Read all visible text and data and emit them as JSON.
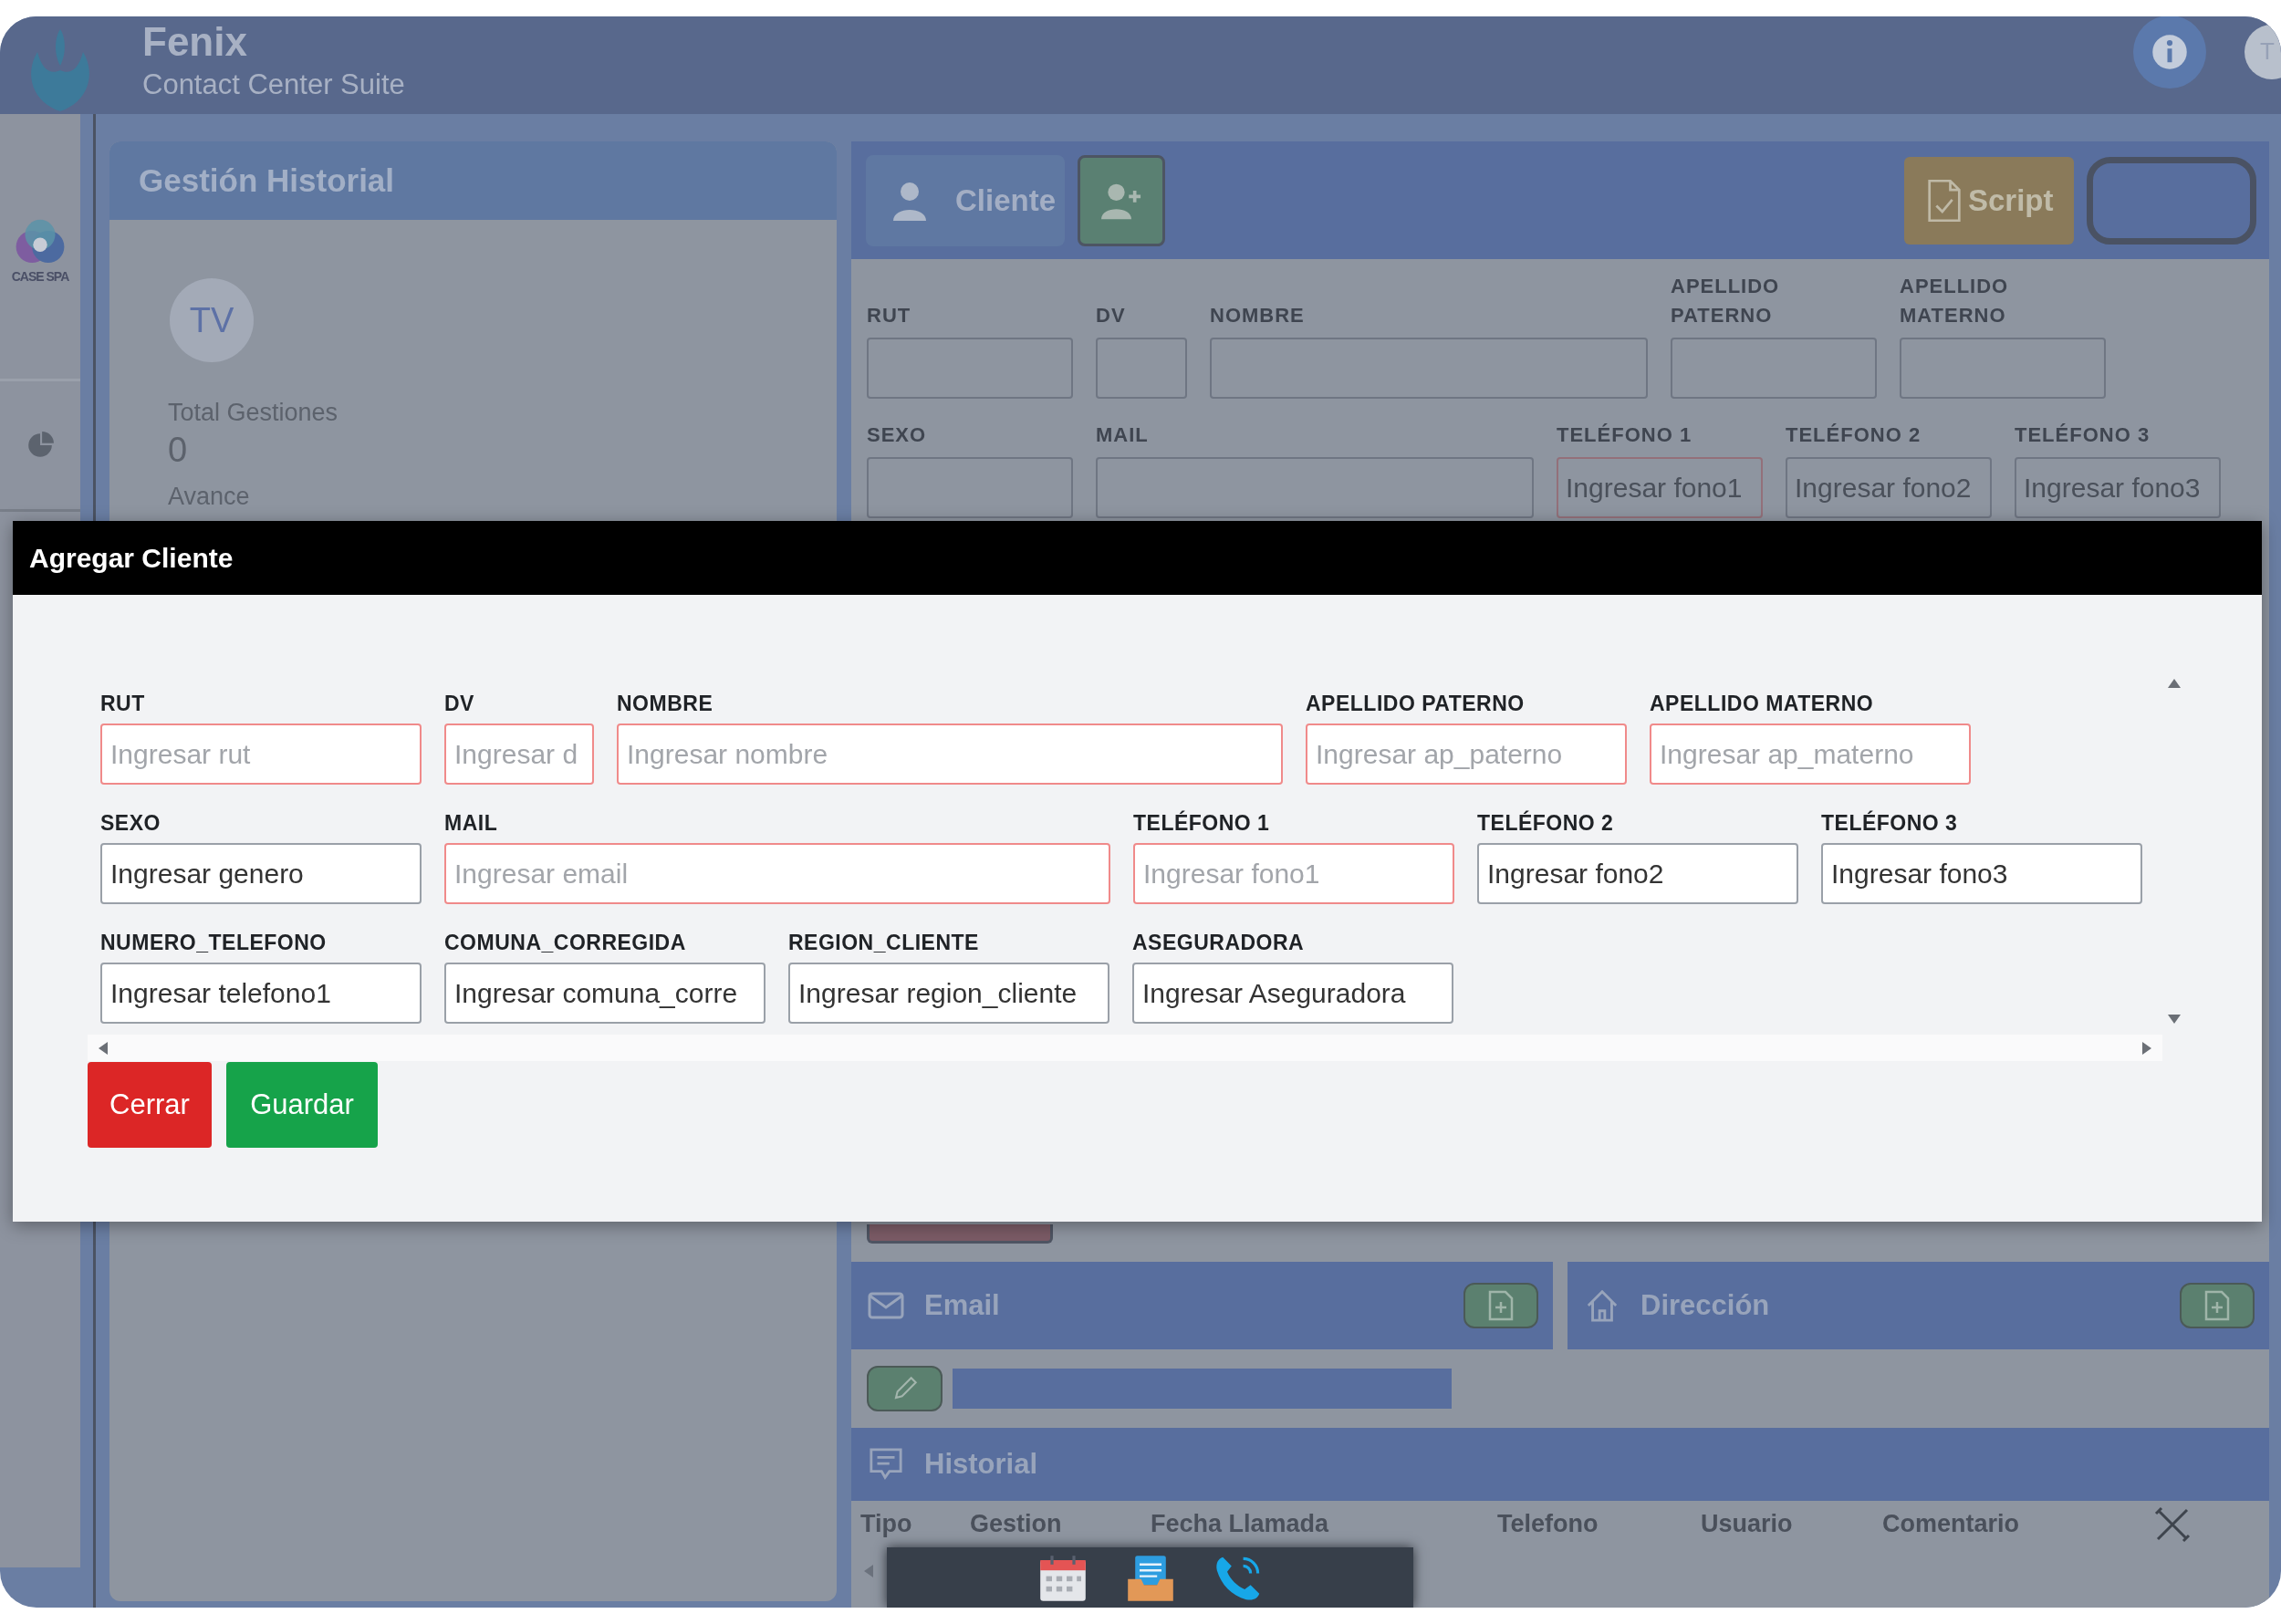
{
  "header": {
    "app_name": "Fenix",
    "subtitle": "Contact Center Suite",
    "avatar": "T"
  },
  "sidebar": {
    "logo_text": "CASE SPA"
  },
  "history_panel": {
    "title": "Gestión Historial",
    "avatar": "TV",
    "total_label": "Total Gestiones",
    "total_value": "0",
    "progress_label": "Avance"
  },
  "client_panel": {
    "tab": "Cliente",
    "script_button": "Script",
    "fields": [
      {
        "label": "RUT",
        "invalid": false
      },
      {
        "label": "DV",
        "invalid": false
      },
      {
        "label": "NOMBRE",
        "invalid": false
      },
      {
        "label": "APELLIDO PATERNO",
        "invalid": false
      },
      {
        "label": "APELLIDO MATERNO",
        "invalid": false
      },
      {
        "label": "SEXO",
        "invalid": false
      },
      {
        "label": "MAIL",
        "invalid": false
      },
      {
        "label": "TELÉFONO 1",
        "placeholder": "Ingresar fono1",
        "invalid": true
      },
      {
        "label": "TELÉFONO 2",
        "placeholder": "Ingresar fono2",
        "invalid": false
      },
      {
        "label": "TELÉFONO 3",
        "placeholder": "Ingresar fono3",
        "invalid": false
      }
    ],
    "email_section": "Email",
    "address_section": "Dirección",
    "history_section": "Historial",
    "history_columns": [
      "Tipo",
      "Gestion",
      "Fecha Llamada",
      "Telefono",
      "Usuario",
      "Comentario"
    ]
  },
  "modal": {
    "title": "Agregar Cliente",
    "rows": [
      [
        {
          "label": "RUT",
          "placeholder": "Ingresar rut",
          "invalid": true
        },
        {
          "label": "DV",
          "placeholder": "Ingresar d",
          "invalid": true
        },
        {
          "label": "NOMBRE",
          "placeholder": "Ingresar nombre",
          "invalid": true
        },
        {
          "label": "APELLIDO PATERNO",
          "placeholder": "Ingresar ap_paterno",
          "invalid": true
        },
        {
          "label": "APELLIDO MATERNO",
          "placeholder": "Ingresar ap_materno",
          "invalid": true
        }
      ],
      [
        {
          "label": "SEXO",
          "placeholder": "Ingresar genero",
          "invalid": false
        },
        {
          "label": "MAIL",
          "placeholder": "Ingresar email",
          "invalid": true
        },
        {
          "label": "TELÉFONO 1",
          "placeholder": "Ingresar fono1",
          "invalid": true
        },
        {
          "label": "TELÉFONO 2",
          "placeholder": "Ingresar fono2",
          "invalid": false
        },
        {
          "label": "TELÉFONO 3",
          "placeholder": "Ingresar fono3",
          "invalid": false
        }
      ],
      [
        {
          "label": "NUMERO_TELEFONO",
          "placeholder": "Ingresar telefono1",
          "invalid": false
        },
        {
          "label": "COMUNA_CORREGIDA",
          "placeholder": "Ingresar comuna_corre",
          "invalid": false
        },
        {
          "label": "REGION_CLIENTE",
          "placeholder": "Ingresar region_cliente",
          "invalid": false
        },
        {
          "label": "ASEGURADORA",
          "placeholder": "Ingresar Aseguradora",
          "invalid": false
        }
      ]
    ],
    "buttons": [
      {
        "label": "Cerrar",
        "kind": "danger"
      },
      {
        "label": "Guardar",
        "kind": "success"
      }
    ]
  }
}
